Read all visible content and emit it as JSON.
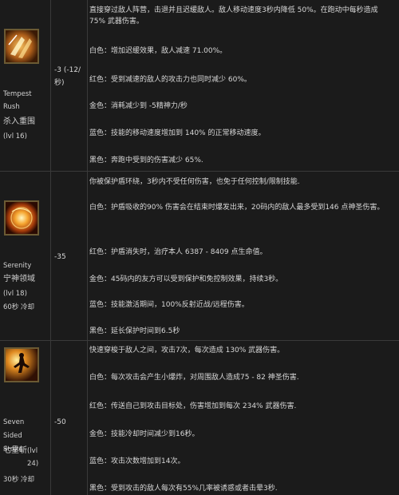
{
  "skills": [
    {
      "name_en": "Tempest Rush",
      "name_cn": "杀入重围",
      "level": "(lvl 16)",
      "cost": "-3 (-12/秒)",
      "lines": [
        "直接穿过敌人阵营，击退并且迟缓敌人。敌人移动速度3秒内降低 50%。在跑动中每秒造成 75% 武器伤害。",
        "白色：增加迟缓效果，敌人减速 71.00%。",
        "红色：受到减速的敌人的攻击力也同时减少 60%。",
        "金色：消耗减少到 -5精神力/秒",
        "蓝色：技能的移动速度增加到 140% 的正常移动速度。",
        "黑色：奔跑中受到的伤害减少 65%."
      ]
    },
    {
      "name_en": "Serenity",
      "name_cn": "宁神领域",
      "level": "(lvl 18)",
      "cooldown": "60秒 冷却",
      "cost": "-35",
      "lines": [
        "你被保护盾环绕，3秒内不受任何伤害，也免于任何控制/限制技能.",
        "白色：护盾吸收的90% 伤害会在结束时爆发出来，20码内的敌人最多受到146 点神圣伤害。",
        "红色：护盾消失时，治疗本人 6387 - 8409 点生命值。",
        "金色：45码内的友方可以受到保护和免控制效果，持续3秒。",
        "蓝色：技能激活期间，100%反射近战/远程伤害。",
        "黑色：延长保护时间到6.5秒"
      ]
    },
    {
      "name_en": "Seven Sided Strike",
      "name_cn": "七星斩",
      "level": "(lvl 24)",
      "cooldown": "30秒 冷却",
      "cost": "-50",
      "lines": [
        "快速穿梭于敌人之间，攻击7次，每次造成 130% 武器伤害。",
        "白色：每次攻击会产生小爆炸，对周围敌人造成75 - 82 神圣伤害.",
        "红色：传送自己到攻击目标处，伤害增加到每次 234% 武器伤害.",
        "金色：技能冷却时间减少到16秒。",
        "蓝色：攻击次数增加到14次。",
        "黑色：受到攻击的敌人每次有55%几率被诱惑或者击晕3秒."
      ]
    }
  ],
  "icons": [
    "tempest-rush-icon",
    "serenity-icon",
    "seven-sided-strike-icon"
  ]
}
